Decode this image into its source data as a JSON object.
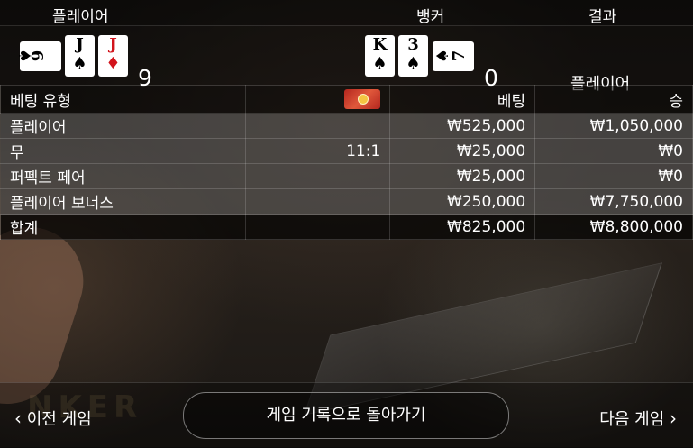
{
  "header": {
    "player": "플레이어",
    "banker": "뱅커",
    "result": "결과"
  },
  "hand": {
    "player_cards": [
      {
        "rank": "6",
        "suit": "♠",
        "color": "#000000",
        "orientation": "sideways"
      },
      {
        "rank": "J",
        "suit": "♠",
        "color": "#000000",
        "orientation": "upright"
      },
      {
        "rank": "J",
        "suit": "♦",
        "color": "#d2141c",
        "orientation": "upright"
      }
    ],
    "player_score": "9",
    "banker_cards": [
      {
        "rank": "K",
        "suit": "♠",
        "color": "#000000",
        "orientation": "upright"
      },
      {
        "rank": "3",
        "suit": "♠",
        "color": "#000000",
        "orientation": "upright"
      },
      {
        "rank": "7",
        "suit": "♠",
        "color": "#000000",
        "orientation": "sideways"
      }
    ],
    "banker_score": "0",
    "result": "플레이어"
  },
  "table": {
    "headers": {
      "bet_type": "베팅 유형",
      "odds_icon": "chip-icon",
      "bet": "베팅",
      "win": "승"
    },
    "rows": [
      {
        "type": "플레이어",
        "odds": "",
        "bet": "₩525,000",
        "win": "₩1,050,000"
      },
      {
        "type": "무",
        "odds": "11:1",
        "bet": "₩25,000",
        "win": "₩0"
      },
      {
        "type": "퍼펙트 페어",
        "odds": "",
        "bet": "₩25,000",
        "win": "₩0"
      },
      {
        "type": "플레이어 보너스",
        "odds": "",
        "bet": "₩250,000",
        "win": "₩7,750,000"
      }
    ],
    "total": {
      "label": "합계",
      "bet": "₩825,000",
      "win": "₩8,800,000"
    }
  },
  "footer": {
    "prev_label": "이전 게임",
    "back_label": "게임 기록으로 돌아가기",
    "next_label": "다음 게임"
  }
}
